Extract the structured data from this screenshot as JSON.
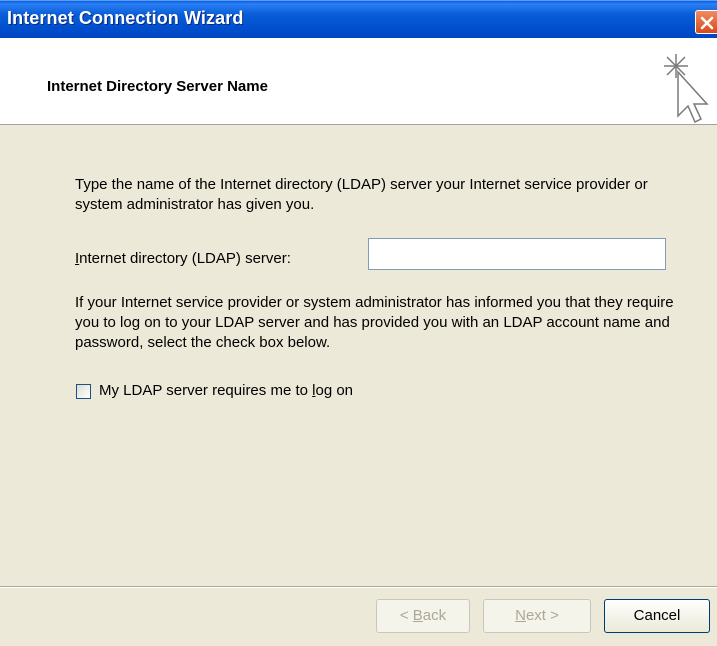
{
  "window": {
    "title": "Internet Connection Wizard",
    "close_icon": "close-icon"
  },
  "header": {
    "heading": "Internet Directory Server Name",
    "icon": "wizard-cursor-sparkle-icon"
  },
  "main": {
    "intro_text": "Type the name of the Internet directory (LDAP) server your Internet service provider or system administrator has given you.",
    "server_label": {
      "access_key": "I",
      "rest": "nternet directory (LDAP) server:"
    },
    "server_value": "",
    "info_text": "If your Internet service provider or system administrator has informed you that they require you to log on to your LDAP server and has provided you with an LDAP account name and password, select the check box below.",
    "logon_checkbox": {
      "checked": false,
      "label_before": "My LDAP server requires me to ",
      "access_key": "l",
      "label_after": "og on"
    }
  },
  "footer": {
    "back": {
      "prefix": "< ",
      "access_key": "B",
      "rest": "ack",
      "enabled": false
    },
    "next": {
      "access_key": "N",
      "rest": "ext >",
      "enabled": false
    },
    "cancel": {
      "label": "Cancel",
      "enabled": true
    }
  },
  "colors": {
    "titlebar": "#0054e3",
    "dialog_bg": "#ece9d8",
    "disabled_text": "#aca899"
  }
}
